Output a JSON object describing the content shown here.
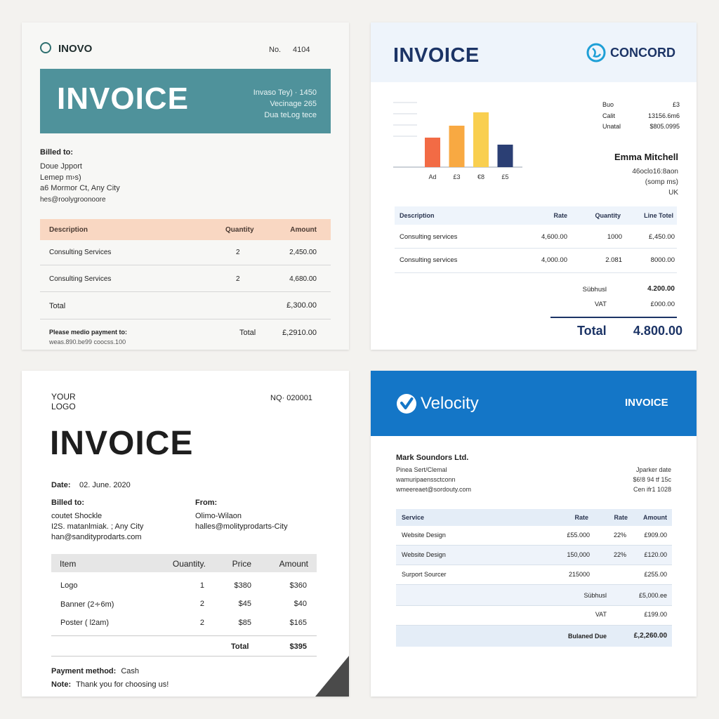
{
  "card1": {
    "brand": "INOVO",
    "number_label": "No.",
    "number": "4104",
    "title": "INVOICE",
    "meta": [
      "Invaso Tey) · 1450",
      "Vecinage 265",
      "Dua teLog tece"
    ],
    "billed_label": "Billed to:",
    "billed": [
      "Doue Jpport",
      "Lemep m›s)",
      "a6 Mormor Ct, Any City",
      "hes@roolygroonoore"
    ],
    "columns": [
      "Description",
      "Quantity",
      "Amount"
    ],
    "rows": [
      {
        "desc": "Consulting Services",
        "qty": "2",
        "amount": "2,450.00"
      },
      {
        "desc": "Consulting Services",
        "qty": "2",
        "amount": "4,680.00"
      }
    ],
    "total_label": "Total",
    "total_value": "£,300.00",
    "payment_label": "Please medio payment to:",
    "payment_detail": "weas.890.be99 coocss.100",
    "footer_total_label": "Total",
    "footer_total_value": "£,2910.00",
    "colors": {
      "banner": "#4f929b",
      "header_row": "#f9d7c2"
    }
  },
  "card2": {
    "title": "INVOICE",
    "brand": "CONCORD",
    "meta": [
      {
        "label": "Buo",
        "value": "£3"
      },
      {
        "label": "Calit",
        "value": "13156.6m6"
      },
      {
        "label": "Unatal",
        "value": "$805.0995"
      }
    ],
    "client_name": "Emma Mitchell",
    "client_lines": [
      "46oclo16:8aon",
      "(somp ms)",
      "UK"
    ],
    "chart_data": {
      "type": "bar",
      "categories": [
        "Ad",
        "£3",
        "€8",
        "£5"
      ],
      "values": [
        42,
        59,
        78,
        32
      ],
      "colors": [
        "#f26b45",
        "#f8a942",
        "#f9cf4f",
        "#2b3f74"
      ],
      "ylim": [
        0,
        100
      ],
      "grid": true
    },
    "columns": [
      "Description",
      "Rate",
      "Quantity",
      "Line Totel"
    ],
    "rows": [
      {
        "desc": "Consulting services",
        "rate": "4,600.00",
        "qty": "1000",
        "total": "£,450.00"
      },
      {
        "desc": "Consulting services",
        "rate": "4,000.00",
        "qty": "2.081",
        "total": "8000.00"
      }
    ],
    "subtotal_label": "Sübhusl",
    "subtotal_value": "4.200.00",
    "vat_label": "VAT",
    "vat_value": "£000.00",
    "total_label": "Total",
    "total_value": "4.800.00",
    "colors": {
      "accent": "#1c3466",
      "header_bg": "#eef4fb"
    }
  },
  "card3": {
    "logo_line1": "YOUR",
    "logo_line2": "LOGO",
    "number": "NQ· 020001",
    "title": "INVOICE",
    "date_label": "Date:",
    "date_value": "02. June. 2020",
    "billed_label": "Billed to:",
    "billed": [
      "coutet Shockle",
      "I2S. matanlmiak. ; Any City",
      "han@sandityprodarts.com"
    ],
    "from_label": "From:",
    "from": [
      "Olimo-Wilaon",
      "halles@molityprodarts-City"
    ],
    "columns": [
      "Item",
      "Ouantity.",
      "Price",
      "Amount"
    ],
    "rows": [
      {
        "item": "Logo",
        "qty": "1",
        "price": "$380",
        "amount": "$360"
      },
      {
        "item": "Banner (2∻6m)",
        "qty": "2",
        "price": "$45",
        "amount": "$40"
      },
      {
        "item": "Poster ( l2am)",
        "qty": "2",
        "price": "$85",
        "amount": "$165"
      }
    ],
    "total_label": "Total",
    "total_value": "$395",
    "payment_label": "Payment method:",
    "payment_value": "Cash",
    "note_label": "Note:",
    "note_value": "Thank you for choosing us!"
  },
  "card4": {
    "brand": "Velocity",
    "title": "INVOICE",
    "company": "Mark Soundors Ltd.",
    "left_lines": [
      "Pinea Sert/Clemal",
      "wamuripaenssctconn",
      "wmeereaet@sordouty.com"
    ],
    "right_lines": [
      "Jparker date",
      "$6!8 94 tf 15c",
      "Cen ifr1 1028"
    ],
    "columns": [
      "Service",
      "Rate",
      "Rate",
      "Amount"
    ],
    "rows": [
      {
        "service": "Website Design",
        "rate": "£55.000",
        "pct": "22%",
        "amount": "£909.00"
      },
      {
        "service": "Website Design",
        "rate": "150,000",
        "pct": "22%",
        "amount": "£120.00"
      },
      {
        "service": "Surport Sourcer",
        "rate": "215000",
        "pct": "",
        "amount": "£255.00"
      }
    ],
    "subtotal_label": "Sübhusl",
    "subtotal_value": "£5,000.ee",
    "vat_label": "VAT",
    "vat_value": "£199.00",
    "due_label": "Bulaned Due",
    "due_value": "£,2,260.00",
    "colors": {
      "header": "#1476c7"
    }
  }
}
